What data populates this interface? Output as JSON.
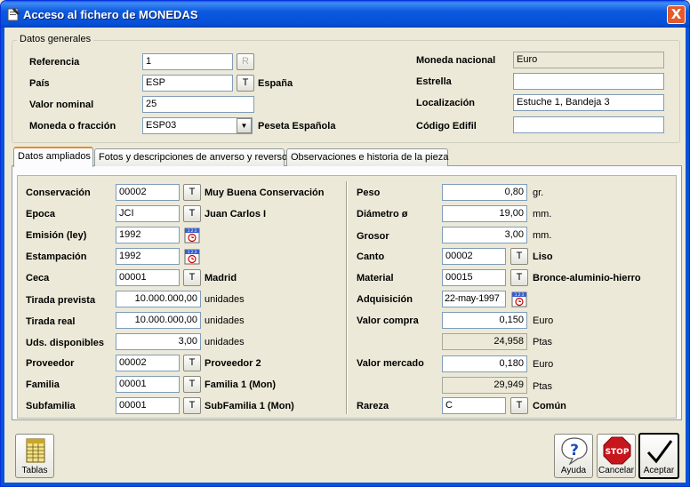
{
  "window": {
    "title": "Acceso al fichero de MONEDAS",
    "close": "X"
  },
  "general": {
    "legend": "Datos generales",
    "referencia": {
      "label": "Referencia",
      "value": "1",
      "btn": "R"
    },
    "pais": {
      "label": "País",
      "value": "ESP",
      "btn": "T",
      "desc": "España"
    },
    "valor_nominal": {
      "label": "Valor nominal",
      "value": "25"
    },
    "moneda_fraccion": {
      "label": "Moneda o fracción",
      "value": "ESP03",
      "desc": "Peseta Española"
    },
    "moneda_nacional": {
      "label": "Moneda nacional",
      "value": "Euro"
    },
    "estrella": {
      "label": "Estrella",
      "value": ""
    },
    "localizacion": {
      "label": "Localización",
      "value": "Estuche 1, Bandeja 3"
    },
    "codigo_edifil": {
      "label": "Código Edifil",
      "value": ""
    }
  },
  "tabs": [
    {
      "label": "Datos ampliados"
    },
    {
      "label": "Fotos y descripciones de anverso y reverso"
    },
    {
      "label": "Observaciones e historia de la pieza"
    }
  ],
  "left": {
    "conservacion": {
      "label": "Conservación",
      "value": "00002",
      "btn": "T",
      "desc": "Muy Buena Conservación"
    },
    "epoca": {
      "label": "Epoca",
      "value": "JCI",
      "btn": "T",
      "desc": "Juan Carlos I"
    },
    "emision": {
      "label": "Emisión (ley)",
      "value": "1992"
    },
    "estampacion": {
      "label": "Estampación",
      "value": "1992"
    },
    "ceca": {
      "label": "Ceca",
      "value": "00001",
      "btn": "T",
      "desc": "Madrid"
    },
    "tirada_prevista": {
      "label": "Tirada prevista",
      "value": "10.000.000,00",
      "unit": "unidades"
    },
    "tirada_real": {
      "label": "Tirada real",
      "value": "10.000.000,00",
      "unit": "unidades"
    },
    "uds_disponibles": {
      "label": "Uds. disponibles",
      "value": "3,00",
      "unit": "unidades"
    },
    "proveedor": {
      "label": "Proveedor",
      "value": "00002",
      "btn": "T",
      "desc": "Proveedor 2"
    },
    "familia": {
      "label": "Familia",
      "value": "00001",
      "btn": "T",
      "desc": "Familia 1 (Mon)"
    },
    "subfamilia": {
      "label": "Subfamilia",
      "value": "00001",
      "btn": "T",
      "desc": "SubFamilia 1 (Mon)"
    }
  },
  "right": {
    "peso": {
      "label": "Peso",
      "value": "0,80",
      "unit": "gr."
    },
    "diametro": {
      "label": "Diámetro ø",
      "value": "19,00",
      "unit": "mm."
    },
    "grosor": {
      "label": "Grosor",
      "value": "3,00",
      "unit": "mm."
    },
    "canto": {
      "label": "Canto",
      "value": "00002",
      "btn": "T",
      "desc": "Liso"
    },
    "material": {
      "label": "Material",
      "value": "00015",
      "btn": "T",
      "desc": "Bronce-aluminio-hierro"
    },
    "adquisicion": {
      "label": "Adquisición",
      "value": "22-may-1997"
    },
    "valor_compra": {
      "label": "Valor compra",
      "value": "0,150",
      "unit": "Euro",
      "ptas": "24,958",
      "ptas_unit": "Ptas"
    },
    "valor_mercado": {
      "label": "Valor mercado",
      "value": "0,180",
      "unit": "Euro",
      "ptas": "29,949",
      "ptas_unit": "Ptas"
    },
    "rareza": {
      "label": "Rareza",
      "value": "C",
      "btn": "T",
      "desc": "Común"
    }
  },
  "buttons": {
    "tablas": "Tablas",
    "ayuda": "Ayuda",
    "cancelar": "Cancelar",
    "aceptar": "Aceptar",
    "stop": "STOP"
  },
  "calendar_text": "1 2 3",
  "colors": {
    "titlebar": "#0553d9",
    "face": "#ece9d8",
    "tab_accent": "#e68b2c",
    "field_border": "#7f9db9"
  }
}
